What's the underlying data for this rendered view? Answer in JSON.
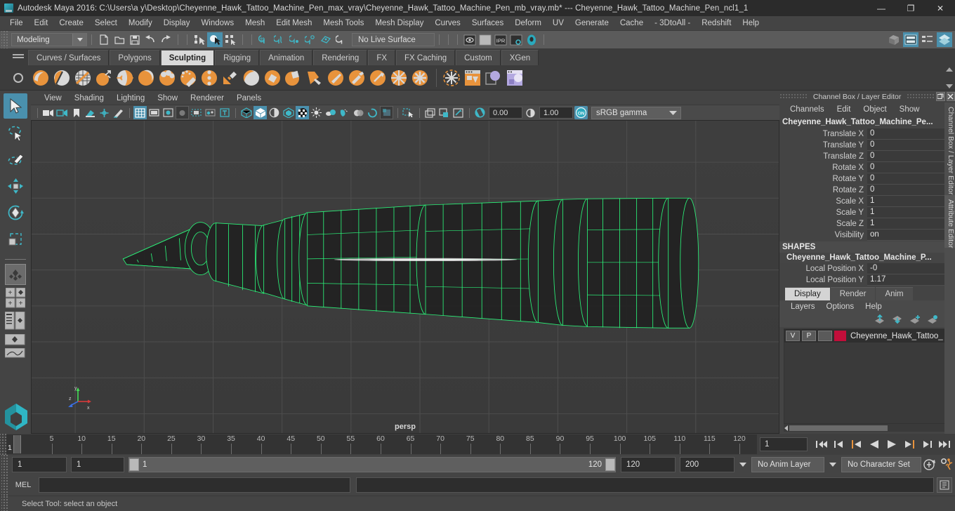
{
  "titlebar": {
    "app_title": "Autodesk Maya 2016: C:\\Users\\a y\\Desktop\\Cheyenne_Hawk_Tattoo_Machine_Pen_max_vray\\Cheyenne_Hawk_Tattoo_Machine_Pen_mb_vray.mb*  ---  Cheyenne_Hawk_Tattoo_Machine_Pen_ncl1_1",
    "minimize": "—",
    "maximize": "❐",
    "close": "✕",
    "logo_icon": "maya-logo-icon"
  },
  "menubar": {
    "items": [
      "File",
      "Edit",
      "Create",
      "Select",
      "Modify",
      "Display",
      "Windows",
      "Mesh",
      "Edit Mesh",
      "Mesh Tools",
      "Mesh Display",
      "Curves",
      "Surfaces",
      "Deform",
      "UV",
      "Generate",
      "Cache",
      "- 3DtoAll -",
      "Redshift",
      "Help"
    ]
  },
  "statusline": {
    "menu_set": "Modeling",
    "live_surface": "No Live Surface",
    "file_icons": [
      "new-scene-icon",
      "open-scene-icon",
      "save-scene-icon",
      "undo-icon",
      "redo-icon"
    ],
    "select_mode_icons": [
      "select-by-hierarchy-icon",
      "select-by-object-type-icon",
      "select-by-component-type-icon"
    ],
    "snap_icons": [
      "snap-to-grid-icon",
      "snap-to-curve-icon",
      "snap-to-point-icon",
      "snap-to-projected-center-icon",
      "snap-to-view-plane-icon",
      "make-live-icon"
    ],
    "render_icons": [
      "render-current-frame-icon",
      "render-sequence-icon",
      "ipr-render-icon",
      "render-settings-icon",
      "hypershade-icon"
    ],
    "editor_icons": [
      "show-hide-modeling-toolkit-icon",
      "attribute-editor-icon",
      "tool-settings-icon",
      "channel-box-icon"
    ]
  },
  "shelf": {
    "tabs": [
      {
        "label": "Curves / Surfaces",
        "active": false
      },
      {
        "label": "Polygons",
        "active": false
      },
      {
        "label": "Sculpting",
        "active": true
      },
      {
        "label": "Rigging",
        "active": false
      },
      {
        "label": "Animation",
        "active": false
      },
      {
        "label": "Rendering",
        "active": false
      },
      {
        "label": "FX",
        "active": false
      },
      {
        "label": "FX Caching",
        "active": false
      },
      {
        "label": "Custom",
        "active": false
      },
      {
        "label": "XGen",
        "active": false
      }
    ],
    "icons": [
      "sculpt-tool-icon",
      "smooth-tool-icon",
      "relax-tool-icon",
      "grab-tool-icon",
      "pinch-tool-icon",
      "flatten-tool-icon",
      "foamy-tool-icon",
      "spray-tool-icon",
      "repeat-tool-icon",
      "imprint-tool-icon",
      "wax-tool-icon",
      "scrape-tool-icon",
      "fill-tool-icon",
      "knife-tool-icon",
      "smear-tool-icon",
      "bulge-tool-icon",
      "amplify-tool-icon",
      "freeze-tool-icon",
      "freeze-selection-icon",
      "convert-to-frozen-icon",
      "sculpt-layers-icon",
      "mirror-sculpt-icon",
      "bake-sculpt-icon"
    ]
  },
  "toolbox": {
    "items": [
      {
        "name": "select-tool",
        "active": true
      },
      {
        "name": "lasso-select-tool",
        "active": false
      },
      {
        "name": "paint-select-tool",
        "active": false
      },
      {
        "name": "move-tool",
        "active": false
      },
      {
        "name": "rotate-tool",
        "active": false
      },
      {
        "name": "scale-tool",
        "active": false
      }
    ],
    "layouts": [
      "single-perspective-layout",
      "four-view-layout",
      "outliner-persp-layout",
      "hypergraph-persp-layout",
      "persp-graph-layout"
    ]
  },
  "viewport": {
    "menus": [
      "View",
      "Shading",
      "Lighting",
      "Show",
      "Renderer",
      "Panels"
    ],
    "camera_label": "persp",
    "exposure": "0.00",
    "gamma": "1.00",
    "view_transform": "sRGB gamma",
    "gamma_toggle": "ON",
    "axis_labels": {
      "x": "x",
      "y": "y",
      "z": "z"
    },
    "wireframe_color": "#2bf77a",
    "toolbar_icons": [
      "select-camera-icon",
      "camera-attributes-icon",
      "bookmark-icon",
      "image-plane-icon",
      "two-d-pan-zoom-icon",
      "grease-pencil-icon",
      "grid-toggle-icon",
      "film-gate-icon",
      "resolution-gate-icon",
      "gate-mask-icon",
      "film-origin-icon",
      "xray-joints-icon",
      "text-overlay-icon",
      "wireframe-shaded-icon",
      "smooth-shade-all-icon",
      "shade-wireframe-icon",
      "hw-texture-icon",
      "use-all-lights-icon",
      "shadows-icon",
      "screen-space-ao-icon",
      "motion-blur-icon",
      "multisample-aa-icon",
      "depth-of-field-icon",
      "isolate-select-icon",
      "xray-icon",
      "xray-active-components-icon",
      "xray-joints-2-icon",
      "exposure-icon",
      "gamma-icon",
      "color-management-icon"
    ]
  },
  "channelbox": {
    "panel_title": "Channel Box / Layer Editor",
    "undock_icon": "undock-icon",
    "close_icon": "close-icon",
    "menus": [
      "Channels",
      "Edit",
      "Object",
      "Show"
    ],
    "object_name": "Cheyenne_Hawk_Tattoo_Machine_Pe...",
    "transform_attrs": [
      {
        "label": "Translate X",
        "value": "0"
      },
      {
        "label": "Translate Y",
        "value": "0"
      },
      {
        "label": "Translate Z",
        "value": "0"
      },
      {
        "label": "Rotate X",
        "value": "0"
      },
      {
        "label": "Rotate Y",
        "value": "0"
      },
      {
        "label": "Rotate Z",
        "value": "0"
      },
      {
        "label": "Scale X",
        "value": "1"
      },
      {
        "label": "Scale Y",
        "value": "1"
      },
      {
        "label": "Scale Z",
        "value": "1"
      },
      {
        "label": "Visibility",
        "value": "on"
      }
    ],
    "shapes_header": "SHAPES",
    "shape_name": "Cheyenne_Hawk_Tattoo_Machine_P...",
    "shape_attrs": [
      {
        "label": "Local Position X",
        "value": "-0"
      },
      {
        "label": "Local Position Y",
        "value": "1.17"
      }
    ],
    "side_tab_channelbox": "Channel Box / Layer Editor",
    "side_tab_attribute": "Attribute Editor"
  },
  "layereditor": {
    "tabs": [
      {
        "label": "Display",
        "active": true
      },
      {
        "label": "Render",
        "active": false
      },
      {
        "label": "Anim",
        "active": false
      }
    ],
    "menus": [
      "Layers",
      "Options",
      "Help"
    ],
    "buttons": [
      "move-layer-up-icon",
      "move-layer-down-icon",
      "create-new-layer-icon",
      "create-layer-from-selected-icon"
    ],
    "layers": [
      {
        "visibility": "V",
        "playback": "P",
        "type": "",
        "color": "#c20e3a",
        "name": "Cheyenne_Hawk_Tattoo_"
      }
    ]
  },
  "timeslider": {
    "ticks": [
      5,
      10,
      15,
      20,
      25,
      30,
      35,
      40,
      45,
      50,
      55,
      60,
      65,
      70,
      75,
      80,
      85,
      90,
      95,
      100,
      105,
      110,
      115,
      120
    ],
    "current_frame_marker": "1",
    "current_frame_field": "1",
    "playback_buttons": [
      "go-to-start-icon",
      "step-back-keyframe-icon",
      "step-back-frame-icon",
      "play-backwards-icon",
      "play-forwards-icon",
      "step-forward-frame-icon",
      "step-forward-keyframe-icon",
      "go-to-end-icon"
    ]
  },
  "rangeslider": {
    "anim_start": "1",
    "range_start": "1",
    "bar_start_label": "1",
    "bar_end_label": "120",
    "range_end": "120",
    "anim_end": "200",
    "anim_layer": "No Anim Layer",
    "character_set": "No Character Set",
    "auto_key_icon": "auto-keyframe-icon",
    "anim_prefs_icon": "animation-preferences-icon"
  },
  "commandline": {
    "language_label": "MEL",
    "input_value": "",
    "output_value": "",
    "script_editor_icon": "script-editor-icon"
  },
  "statusbar": {
    "help_text": "Select Tool: select an object"
  },
  "colors": {
    "accent_blue": "#4a90ad",
    "shelf_orange": "#e8933c",
    "wireframe_green": "#2bf77a",
    "layer_red": "#c20e3a",
    "panel_bg": "#444444",
    "viewport_bg": "#3c3c3c"
  }
}
